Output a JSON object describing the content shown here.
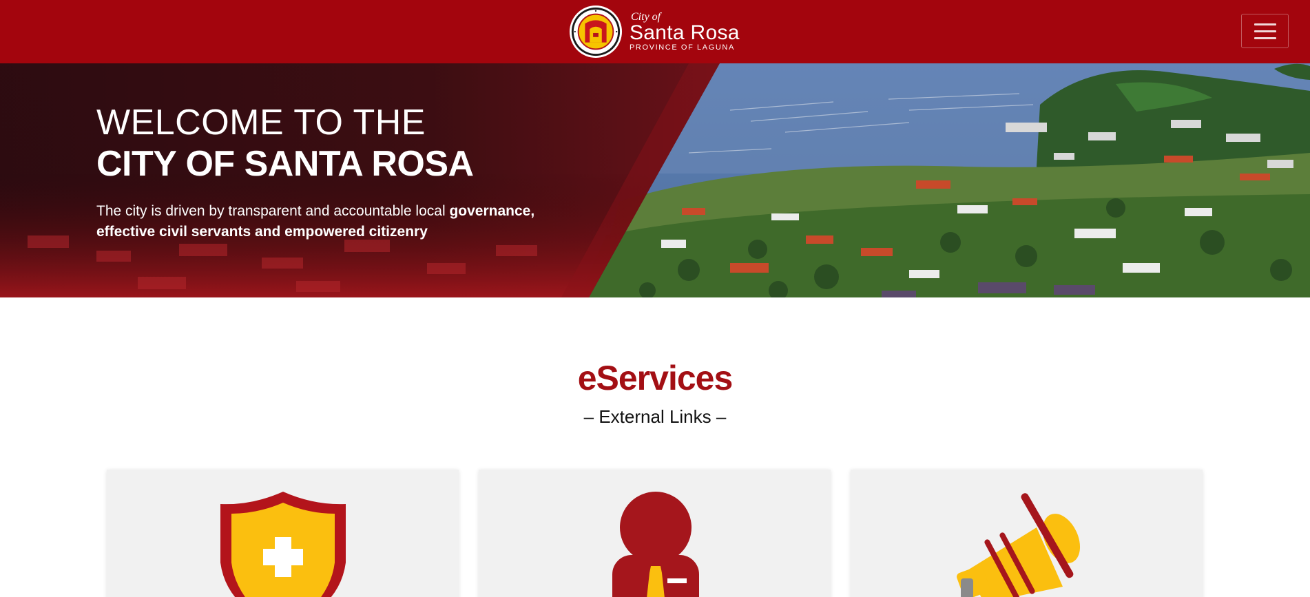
{
  "header": {
    "brand_city_of": "City of",
    "brand_name": "Santa Rosa",
    "brand_province": "PROVINCE OF LAGUNA",
    "seal_icon": "city-seal-icon",
    "menu_icon": "hamburger-menu-icon"
  },
  "hero": {
    "line1": "WELCOME TO THE",
    "line2": "CITY OF SANTA ROSA",
    "desc_part1": "The city is driven by transparent and accountable local ",
    "desc_bold1": "governance,",
    "desc_bold2": "effective civil servants and empowered citizenry"
  },
  "eservices": {
    "title": "eServices",
    "subtitle": "– External Links –",
    "cards": [
      {
        "icon": "health-shield-icon"
      },
      {
        "icon": "employee-icon"
      },
      {
        "icon": "megaphone-icon"
      }
    ]
  },
  "colors": {
    "brand_red": "#a3050d",
    "title_red": "#a30f14",
    "accent_yellow": "#fbbf0f",
    "card_bg": "#f1f1f1"
  }
}
